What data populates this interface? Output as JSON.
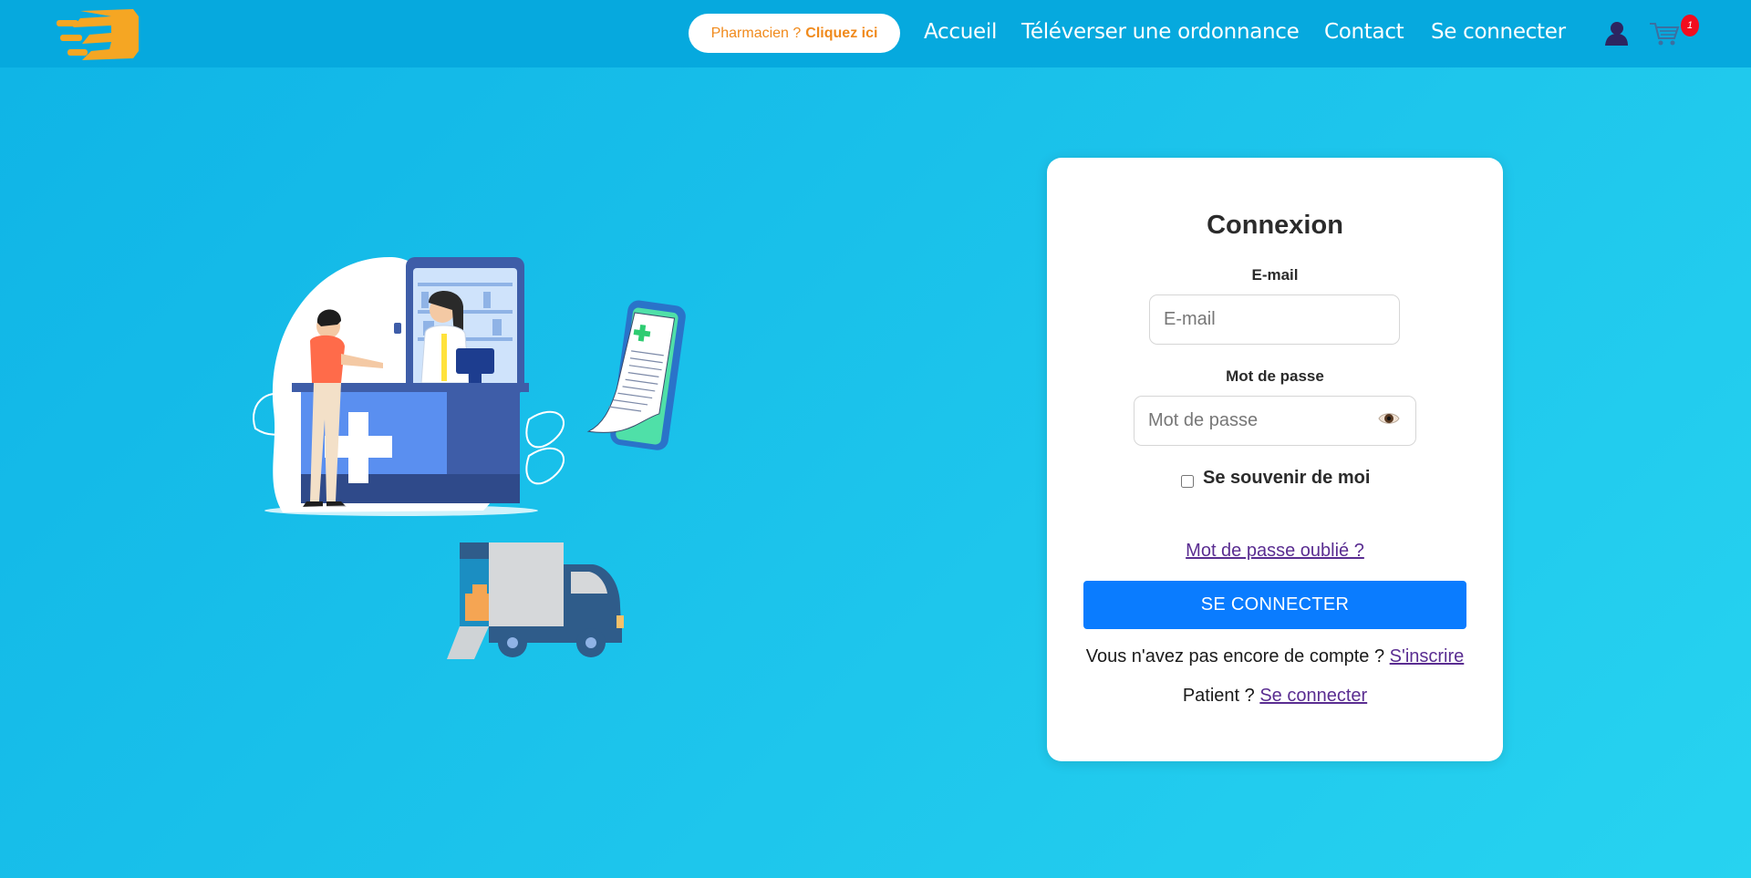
{
  "header": {
    "pharmacist_prefix": "Pharmacien ?",
    "pharmacist_link": "Cliquez ici",
    "nav": [
      "Accueil",
      "Téléverser une ordonnance",
      "Contact",
      "Se connecter"
    ],
    "cart_count": "1"
  },
  "login": {
    "title": "Connexion",
    "email_label": "E-mail",
    "email_placeholder": "E-mail",
    "password_label": "Mot de passe",
    "password_placeholder": "Mot de passe",
    "remember_label": "Se souvenir de moi",
    "forgot_link": "Mot de passe oublié ?",
    "submit_label": "SE CONNECTER",
    "signup_prompt": "Vous n'avez pas encore de compte ?",
    "signup_link": "S'inscrire",
    "patient_prompt": "Patient ?",
    "patient_link": "Se connecter"
  },
  "colors": {
    "accent": "#0a7cff",
    "header": "#06a9de",
    "brand_orange": "#f5a623",
    "badge": "#f20d1e",
    "link": "#5a2d91"
  },
  "icons": [
    "logo",
    "user-icon",
    "cart-icon",
    "eye-icon"
  ]
}
